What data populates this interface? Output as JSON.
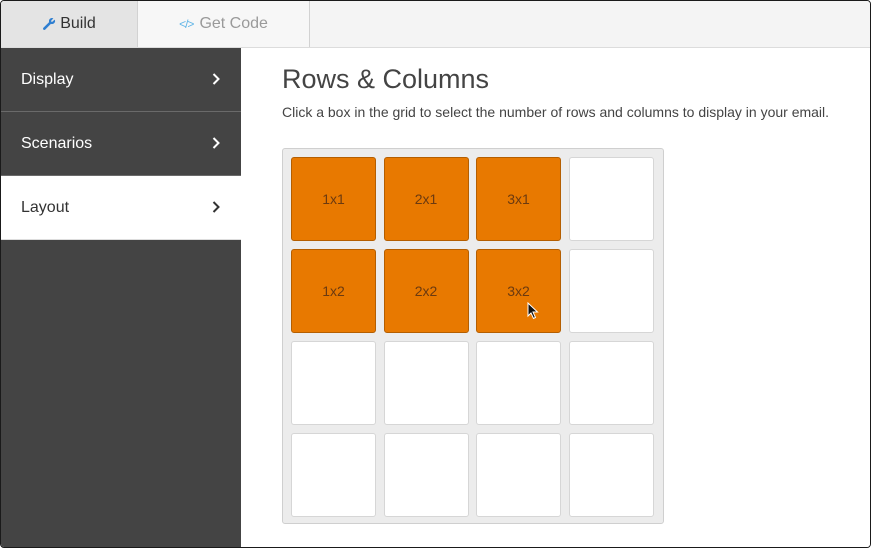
{
  "tabs": {
    "build": {
      "label": "Build",
      "icon": "wrench-icon"
    },
    "get_code": {
      "label": "Get Code",
      "icon": "code-icon",
      "icon_glyph": "</>"
    }
  },
  "sidebar": {
    "items": [
      {
        "label": "Display",
        "active": false
      },
      {
        "label": "Scenarios",
        "active": false
      },
      {
        "label": "Layout",
        "active": true
      }
    ]
  },
  "main": {
    "title": "Rows & Columns",
    "description": "Click a box in the grid to select the number of rows and columns to display in your email."
  },
  "grid": {
    "columns": 4,
    "rows": 4,
    "selected_columns": 3,
    "selected_rows": 2,
    "cells": [
      [
        "1x1",
        "2x1",
        "3x1",
        ""
      ],
      [
        "1x2",
        "2x2",
        "3x2",
        ""
      ],
      [
        "",
        "",
        "",
        ""
      ],
      [
        "",
        "",
        "",
        ""
      ]
    ]
  },
  "colors": {
    "accent": "#e87900",
    "sidebar_bg": "#444444",
    "code_icon": "#62b5e6"
  }
}
